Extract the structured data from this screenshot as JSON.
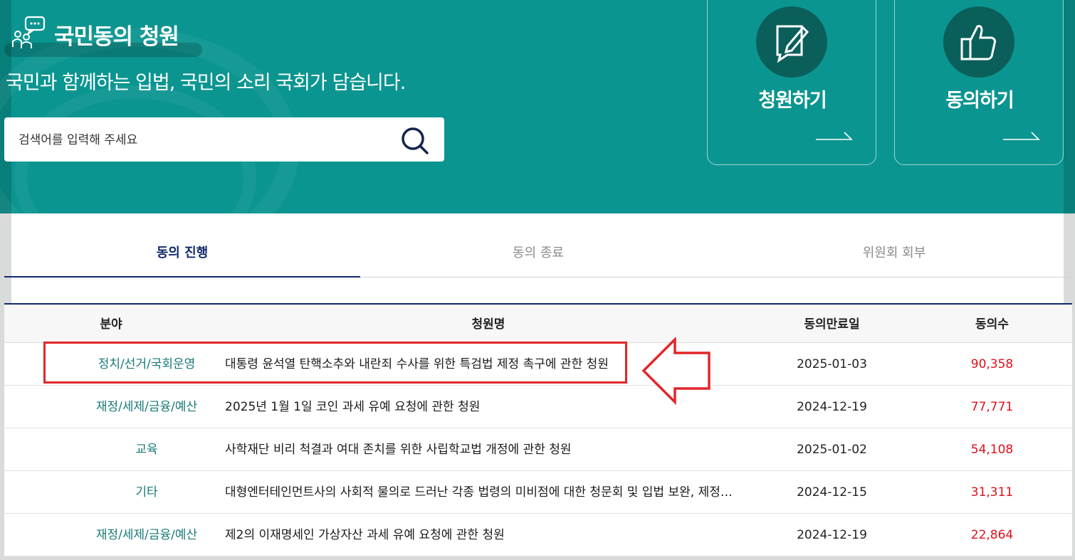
{
  "header": {
    "title": "국민동의 청원",
    "subtitle": "국민과 함께하는 입법, 국민의 소리 국회가 담습니다."
  },
  "search": {
    "placeholder": "검색어를 입력해 주세요"
  },
  "actions": [
    {
      "label": "청원하기",
      "icon": "pencil-edit-icon"
    },
    {
      "label": "동의하기",
      "icon": "thumbs-up-icon"
    }
  ],
  "tabs": [
    {
      "label": "동의 진행",
      "active": true
    },
    {
      "label": "동의 종료",
      "active": false
    },
    {
      "label": "위원회 회부",
      "active": false
    }
  ],
  "table": {
    "headers": [
      "분야",
      "청원명",
      "동의만료일",
      "동의수"
    ],
    "rows": [
      {
        "field": "정치/선거/국회운영",
        "name": "대통령 윤석열 탄핵소추와 내란죄 수사를 위한 특검법 제정 촉구에 관한 청원",
        "date": "2025-01-03",
        "count": "90,358"
      },
      {
        "field": "재정/세제/금융/예산",
        "name": "2025년 1월 1일 코인 과세 유예 요청에 관한 청원",
        "date": "2024-12-19",
        "count": "77,771"
      },
      {
        "field": "교육",
        "name": "사학재단 비리 척결과 여대 존치를 위한 사립학교법 개정에 관한 청원",
        "date": "2025-01-02",
        "count": "54,108"
      },
      {
        "field": "기타",
        "name": "대형엔터테인먼트사의 사회적 물의로 드러난 각종 법령의 미비점에 대한 청문회 및 입법 보완, 제정…",
        "date": "2024-12-15",
        "count": "31,311"
      },
      {
        "field": "재정/세제/금융/예산",
        "name": "제2의 이재명세인 가상자산 과세 유예 요청에 관한 청원",
        "date": "2024-12-19",
        "count": "22,864"
      }
    ]
  },
  "colors": {
    "hero": "#0b9590",
    "tab_active": "#102a6a",
    "field_text": "#187a78",
    "count_text": "#e0101a",
    "highlight": "#e2262a"
  }
}
